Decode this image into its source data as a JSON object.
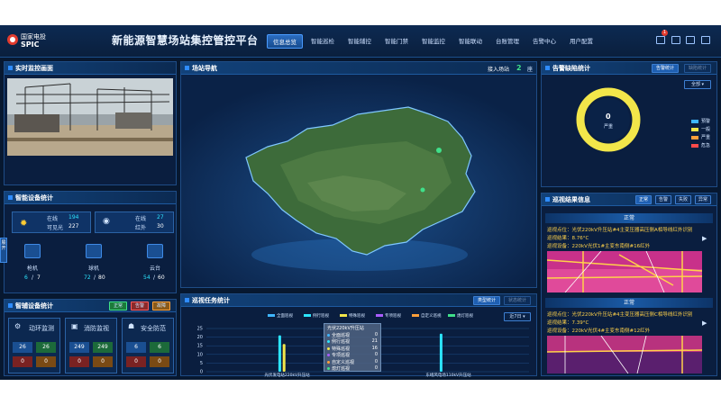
{
  "brand": {
    "name_cn": "国家电投",
    "name_en": "SPIC"
  },
  "app_title": "新能源智慧场站集控管控平台",
  "nav": [
    "信息总览",
    "智能巡检",
    "智能辅控",
    "智能门禁",
    "智能监控",
    "智能联动",
    "台账管理",
    "告警中心",
    "用户配置"
  ],
  "header_badge": "1",
  "side_tab": "展开",
  "live": {
    "title": "实时监控画面"
  },
  "device_stats": {
    "title": "智能设备统计",
    "cam1": {
      "online_label": "在线",
      "online": "194",
      "total_label": "可见光",
      "total": "227"
    },
    "cam2": {
      "online_label": "在线",
      "online": "27",
      "total_label": "红外",
      "total": "30"
    },
    "devices": [
      {
        "name": "枪机",
        "online": "6",
        "total": "7"
      },
      {
        "name": "球机",
        "online": "72",
        "total": "80"
      },
      {
        "name": "云台",
        "online": "54",
        "total": "60"
      }
    ]
  },
  "aux_stats": {
    "title": "智辅设备统计",
    "legend": [
      "正常",
      "告警",
      "故障"
    ],
    "groups": [
      {
        "name": "动环监测",
        "vals": [
          "26",
          "26",
          "0",
          "0"
        ]
      },
      {
        "name": "消防监视",
        "vals": [
          "249",
          "249",
          "0",
          "0"
        ]
      },
      {
        "name": "安全防范",
        "vals": [
          "6",
          "6",
          "0",
          "0"
        ]
      }
    ]
  },
  "station_nav": {
    "title": "场站导航",
    "connected_label": "接入场站",
    "connected": "2",
    "unit": "座"
  },
  "tasks": {
    "title": "巡视任务统计",
    "tab_type": "类型统计",
    "tab_status": "状态统计",
    "range": "近7日",
    "legend": [
      "全面巡视",
      "例行巡视",
      "特殊巡视",
      "专项巡视",
      "自定义巡视",
      "熄灯巡视"
    ],
    "tooltip_title": "光伏220kV升压站",
    "tooltip": [
      [
        "全面巡视",
        "0"
      ],
      [
        "例行巡视",
        "21"
      ],
      [
        "特殊巡视",
        "16"
      ],
      [
        "专项巡视",
        "0"
      ],
      [
        "自定义巡视",
        "0"
      ],
      [
        "熄灯巡视",
        "0"
      ]
    ]
  },
  "alarm": {
    "title": "告警缺陷统计",
    "tab_alarm": "告警统计",
    "tab_defect": "缺陷统计",
    "filter": "全部",
    "center_value": "0",
    "center_label": "严重",
    "legend": [
      "預警",
      "一般",
      "严重",
      "危急"
    ]
  },
  "patrol_result": {
    "title": "巡视结果信息",
    "filters": [
      "正常",
      "告警",
      "失败",
      "异常"
    ],
    "items": [
      {
        "status": "正常",
        "point": "巡视点位：光伏220kV升压站#4主变压器高压侧A相导线红外识别",
        "result": "巡视结果：8.76°C",
        "device": "巡视设备：220kV光伏1#主变东南侧#16红外"
      },
      {
        "status": "正常",
        "point": "巡视点位：光伏220kV升压站#4主变压器高压侧C相导线红外识别",
        "result": "巡视结果：7.39°C",
        "device": "巡视设备：220kV光伏4#主变东南侧#12红外"
      }
    ]
  },
  "chart_data": {
    "type": "bar",
    "categories": [
      "光伏发电站220kV升压站",
      "东峨风电场110kV升压站"
    ],
    "ylim": [
      0,
      25
    ],
    "yticks": [
      "0",
      "5",
      "10",
      "15",
      "20",
      "25"
    ],
    "series": [
      {
        "name": "全面巡视",
        "color": "#3fb6ff",
        "values": [
          0,
          0
        ]
      },
      {
        "name": "例行巡视",
        "color": "#2ce6ff",
        "values": [
          21,
          22
        ]
      },
      {
        "name": "特殊巡视",
        "color": "#f2e64a",
        "values": [
          16,
          0
        ]
      },
      {
        "name": "专项巡视",
        "color": "#a95cff",
        "values": [
          0,
          0
        ]
      },
      {
        "name": "自定义巡视",
        "color": "#ff9f3a",
        "values": [
          0,
          0
        ]
      },
      {
        "name": "熄灯巡视",
        "color": "#3fe08a",
        "values": [
          0,
          0
        ]
      }
    ]
  }
}
